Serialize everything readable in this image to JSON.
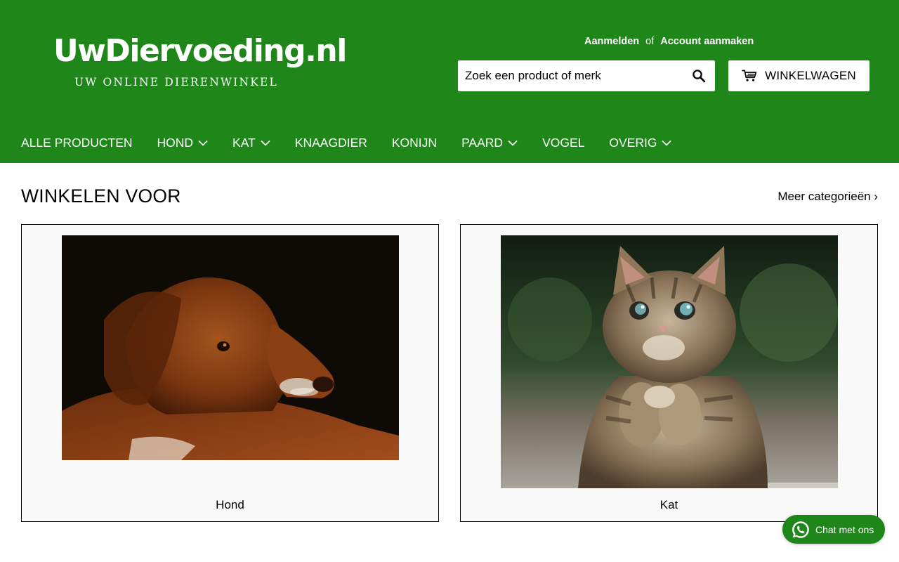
{
  "brand": {
    "name": "UwDiervoeding.nl",
    "tagline": "UW ONLINE DIERENWINKEL"
  },
  "account": {
    "login": "Aanmelden",
    "separator": "of",
    "register": "Account aanmaken"
  },
  "search": {
    "placeholder": "Zoek een product of merk",
    "value": "",
    "icon": "search-icon"
  },
  "cart": {
    "label": "WINKELWAGEN",
    "icon": "cart-icon"
  },
  "nav": {
    "items": [
      {
        "label": "ALLE PRODUCTEN",
        "dropdown": false
      },
      {
        "label": "HOND",
        "dropdown": true
      },
      {
        "label": "KAT",
        "dropdown": true
      },
      {
        "label": "KNAAGDIER",
        "dropdown": false
      },
      {
        "label": "KONIJN",
        "dropdown": false
      },
      {
        "label": "PAARD",
        "dropdown": true
      },
      {
        "label": "VOGEL",
        "dropdown": false
      },
      {
        "label": "OVERIG",
        "dropdown": true
      }
    ]
  },
  "main": {
    "title": "WINKELEN VOOR",
    "more_link": "Meer categorieën ›",
    "categories": [
      {
        "label": "Hond",
        "image": "dog-photo"
      },
      {
        "label": "Kat",
        "image": "cat-photo"
      }
    ]
  },
  "chat": {
    "label": "Chat met ons",
    "icon": "whatsapp-icon"
  },
  "colors": {
    "brand_green": "#1f871a",
    "card_bg": "#f9f9f9",
    "text": "#000000",
    "white": "#ffffff"
  }
}
